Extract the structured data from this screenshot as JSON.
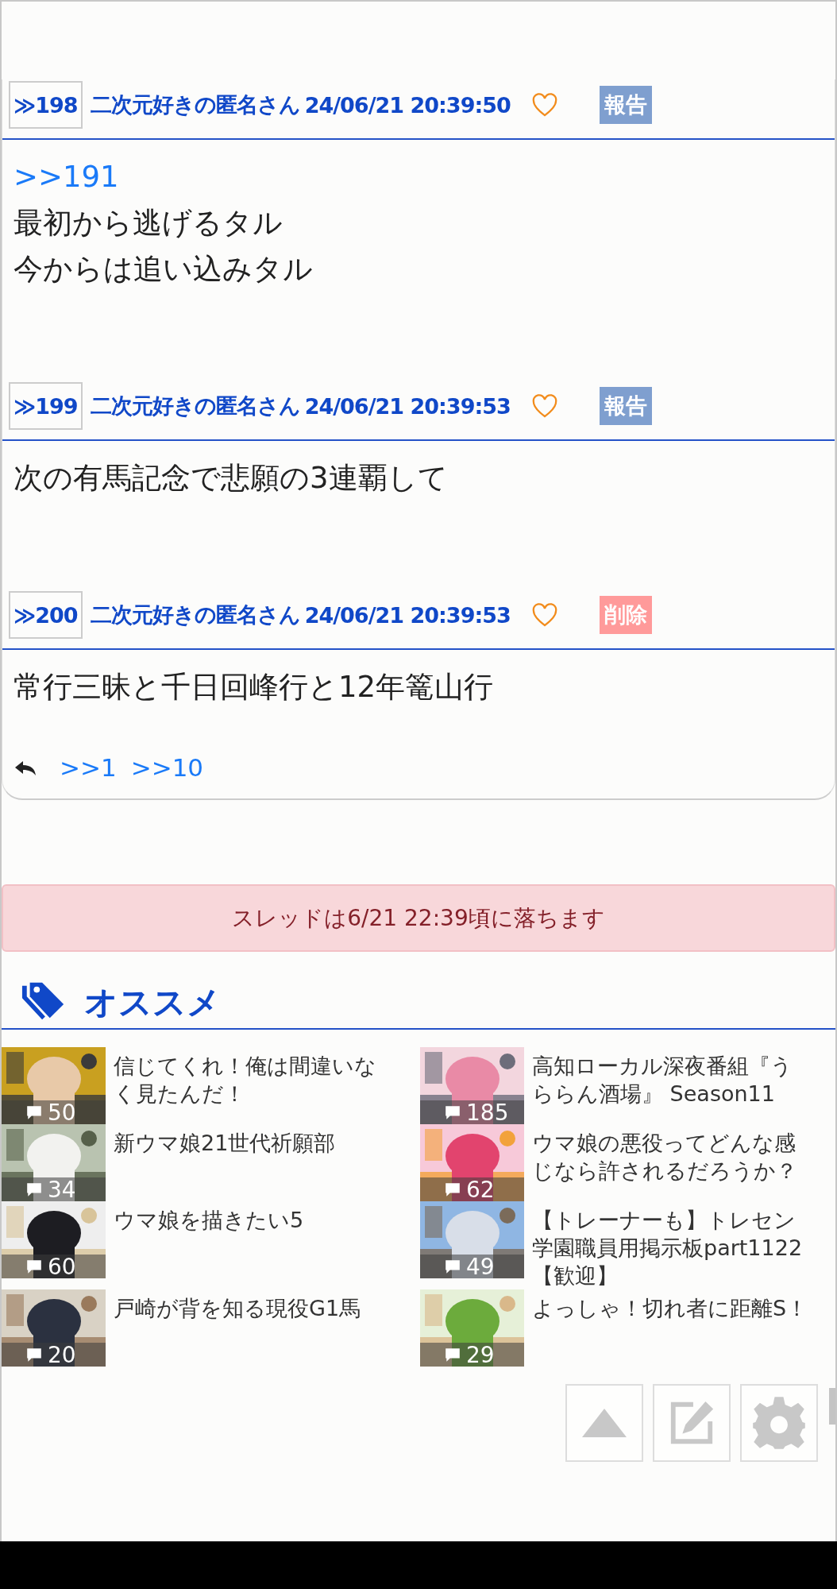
{
  "posts": [
    {
      "number": "≫198",
      "name": "二次元好きの匿名さん",
      "date": "24/06/21 20:39:50",
      "action": {
        "label": "報告",
        "kind": "report"
      },
      "anchor": ">>191",
      "lines": [
        "最初から逃げるタル",
        "今からは追い込みタル"
      ]
    },
    {
      "number": "≫199",
      "name": "二次元好きの匿名さん",
      "date": "24/06/21 20:39:53",
      "action": {
        "label": "報告",
        "kind": "report"
      },
      "lines": [
        "次の有馬記念で悲願の3連覇して"
      ]
    },
    {
      "number": "≫200",
      "name": "二次元好きの匿名さん",
      "date": "24/06/21 20:39:53",
      "action": {
        "label": "削除",
        "kind": "delete"
      },
      "lines": [
        "常行三昧と千日回峰行と12年篭山行"
      ],
      "replies": [
        ">>1",
        ">>10"
      ]
    }
  ],
  "notice": "スレッドは6/21 22:39頃に落ちます",
  "recommend": {
    "title": "オススメ",
    "items": [
      {
        "title": "信じてくれ！俺は間違いなく見たんだ！",
        "comments": "50"
      },
      {
        "title": "高知ローカル深夜番組『うららん酒場』 Season11",
        "comments": "185"
      },
      {
        "title": "新ウマ娘21世代祈願部",
        "comments": "34"
      },
      {
        "title": "ウマ娘の悪役ってどんな感じなら許されるだろうか？",
        "comments": "62"
      },
      {
        "title": "ウマ娘を描きたい5",
        "comments": "60"
      },
      {
        "title": "【トレーナーも】トレセン学園職員用掲示板part1122【歓迎】",
        "comments": "49"
      },
      {
        "title": "戸崎が背を知る現役G1馬",
        "comments": "20"
      },
      {
        "title": "よっしゃ！切れ者に距離S！",
        "comments": "29"
      }
    ]
  }
}
